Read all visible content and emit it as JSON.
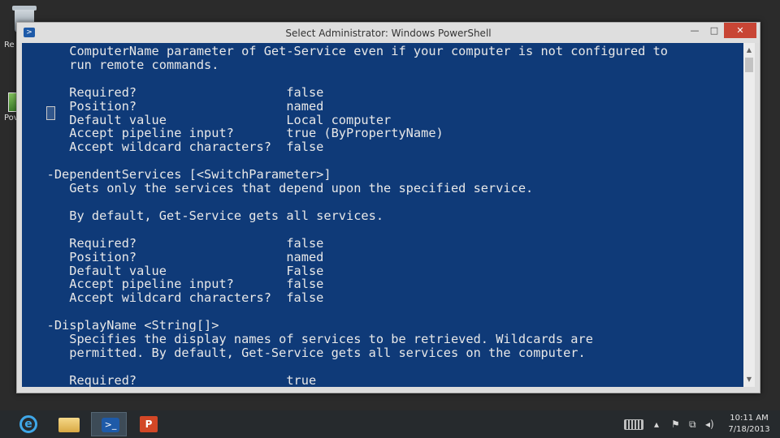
{
  "desktop": {
    "label_recycle": "Re",
    "label_powerpoint": "Pov"
  },
  "window": {
    "title": "Select Administrator: Windows PowerShell",
    "minimize_glyph": "—",
    "maximize_glyph": "□",
    "close_glyph": "✕"
  },
  "console": {
    "lines": [
      "      ComputerName parameter of Get-Service even if your computer is not configured to",
      "      run remote commands.",
      "",
      "      Required?                    false",
      "      Position?                    named",
      "      Default value                Local computer",
      "      Accept pipeline input?       true (ByPropertyName)",
      "      Accept wildcard characters?  false",
      "",
      "   -DependentServices [<SwitchParameter>]",
      "      Gets only the services that depend upon the specified service.",
      "",
      "      By default, Get-Service gets all services.",
      "",
      "      Required?                    false",
      "      Position?                    named",
      "      Default value                False",
      "      Accept pipeline input?       false",
      "      Accept wildcard characters?  false",
      "",
      "   -DisplayName <String[]>",
      "      Specifies the display names of services to be retrieved. Wildcards are",
      "      permitted. By default, Get-Service gets all services on the computer.",
      "",
      "      Required?                    true"
    ]
  },
  "taskbar": {
    "apps": [
      "internet-explorer",
      "file-explorer",
      "windows-powershell",
      "powerpoint"
    ],
    "ppt_glyph": "P",
    "ps_glyph": ">_",
    "ie_glyph": "e",
    "tray": {
      "up_arrow": "▴",
      "flag": "⚑",
      "network": "⧉",
      "volume": "◂)"
    },
    "clock": {
      "time": "10:11 AM",
      "date": "7/18/2013"
    }
  }
}
